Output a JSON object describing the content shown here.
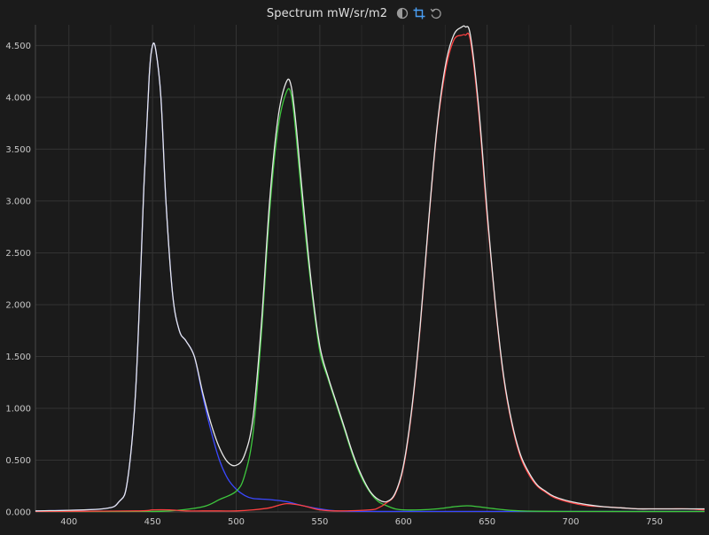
{
  "header": {
    "title": "Spectrum mW/sr/m2"
  },
  "icons": {
    "contrast": "contrast-icon",
    "crop": "crop-icon",
    "reset": "reset-icon"
  },
  "colors": {
    "background": "#1b1b1b",
    "grid": "#333333",
    "axis": "#4a4a4a",
    "accent": "#4a9ff5"
  },
  "chart_data": {
    "type": "line",
    "xlim": [
      380,
      780
    ],
    "ylim": [
      0,
      4.7
    ],
    "x_ticks": [
      400,
      450,
      500,
      550,
      600,
      650,
      700,
      750
    ],
    "y_ticks": [
      {
        "value": 0,
        "label": "0.000"
      },
      {
        "value": 0.5,
        "label": "0.500"
      },
      {
        "value": 1.0,
        "label": "1.000"
      },
      {
        "value": 1.5,
        "label": "1.500"
      },
      {
        "value": 2.0,
        "label": "2.000"
      },
      {
        "value": 2.5,
        "label": "2.500"
      },
      {
        "value": 3.0,
        "label": "3.000"
      },
      {
        "value": 3.5,
        "label": "3.500"
      },
      {
        "value": 4.0,
        "label": "4.000"
      },
      {
        "value": 4.5,
        "label": "4.500"
      }
    ],
    "grid": true,
    "series": [
      {
        "color": "#e8e8e8",
        "x": [
          380,
          420,
          430,
          435,
          440,
          445,
          448,
          450,
          452,
          455,
          458,
          462,
          466,
          470,
          475,
          480,
          485,
          490,
          495,
          500,
          505,
          510,
          515,
          520,
          525,
          530,
          533,
          536,
          540,
          545,
          550,
          555,
          560,
          565,
          570,
          575,
          580,
          585,
          590,
          595,
          600,
          605,
          610,
          615,
          620,
          625,
          630,
          635,
          637,
          640,
          645,
          650,
          655,
          660,
          665,
          670,
          675,
          680,
          685,
          690,
          700,
          710,
          720,
          730,
          740,
          750,
          760,
          770,
          780
        ],
        "y": [
          0.01,
          0.03,
          0.1,
          0.3,
          1.2,
          3.2,
          4.2,
          4.5,
          4.45,
          4.0,
          3.0,
          2.1,
          1.75,
          1.65,
          1.5,
          1.15,
          0.85,
          0.62,
          0.48,
          0.45,
          0.55,
          0.9,
          1.8,
          3.0,
          3.8,
          4.15,
          4.1,
          3.7,
          3.0,
          2.2,
          1.6,
          1.3,
          1.05,
          0.8,
          0.55,
          0.35,
          0.2,
          0.12,
          0.1,
          0.18,
          0.45,
          1.0,
          1.8,
          2.8,
          3.7,
          4.3,
          4.6,
          4.68,
          4.68,
          4.6,
          3.9,
          2.9,
          2.0,
          1.3,
          0.85,
          0.55,
          0.38,
          0.26,
          0.2,
          0.15,
          0.1,
          0.07,
          0.05,
          0.04,
          0.03,
          0.03,
          0.03,
          0.03,
          0.03
        ]
      },
      {
        "color": "#3a48ff",
        "x": [
          380,
          420,
          430,
          435,
          440,
          445,
          448,
          450,
          452,
          455,
          458,
          462,
          466,
          470,
          475,
          480,
          485,
          490,
          495,
          500,
          505,
          510,
          520,
          530,
          540,
          550,
          560,
          580,
          600,
          650,
          700,
          780
        ],
        "y": [
          0.01,
          0.03,
          0.1,
          0.3,
          1.2,
          3.2,
          4.2,
          4.5,
          4.45,
          4.0,
          3.0,
          2.1,
          1.75,
          1.65,
          1.5,
          1.12,
          0.78,
          0.5,
          0.32,
          0.22,
          0.16,
          0.13,
          0.12,
          0.1,
          0.06,
          0.03,
          0.01,
          0.005,
          0.005,
          0.005,
          0.005,
          0.005
        ]
      },
      {
        "color": "#3ec83e",
        "x": [
          380,
          440,
          460,
          480,
          490,
          500,
          505,
          510,
          515,
          520,
          525,
          530,
          533,
          536,
          540,
          545,
          550,
          555,
          560,
          565,
          570,
          575,
          580,
          585,
          590,
          595,
          600,
          610,
          620,
          630,
          638,
          645,
          655,
          670,
          700,
          780
        ],
        "y": [
          0.005,
          0.005,
          0.01,
          0.05,
          0.12,
          0.2,
          0.35,
          0.75,
          1.7,
          2.9,
          3.7,
          4.05,
          4.02,
          3.6,
          2.9,
          2.15,
          1.55,
          1.28,
          1.03,
          0.78,
          0.53,
          0.33,
          0.19,
          0.1,
          0.06,
          0.03,
          0.02,
          0.02,
          0.03,
          0.05,
          0.06,
          0.05,
          0.03,
          0.01,
          0.005,
          0.005
        ]
      },
      {
        "color": "#ff4040",
        "x": [
          380,
          440,
          450,
          460,
          470,
          480,
          490,
          500,
          510,
          520,
          530,
          540,
          550,
          560,
          580,
          585,
          590,
          595,
          600,
          605,
          610,
          615,
          620,
          625,
          630,
          635,
          637,
          640,
          645,
          650,
          655,
          660,
          665,
          670,
          675,
          680,
          685,
          690,
          700,
          710,
          720,
          730,
          740,
          750,
          760,
          770,
          780
        ],
        "y": [
          0.005,
          0.01,
          0.02,
          0.02,
          0.01,
          0.01,
          0.01,
          0.01,
          0.02,
          0.04,
          0.08,
          0.06,
          0.02,
          0.01,
          0.02,
          0.04,
          0.09,
          0.17,
          0.43,
          0.98,
          1.78,
          2.78,
          3.68,
          4.25,
          4.55,
          4.6,
          4.6,
          4.55,
          3.85,
          2.85,
          1.98,
          1.28,
          0.83,
          0.53,
          0.36,
          0.25,
          0.19,
          0.14,
          0.09,
          0.06,
          0.05,
          0.04,
          0.03,
          0.03,
          0.03,
          0.03,
          0.02
        ]
      }
    ]
  }
}
